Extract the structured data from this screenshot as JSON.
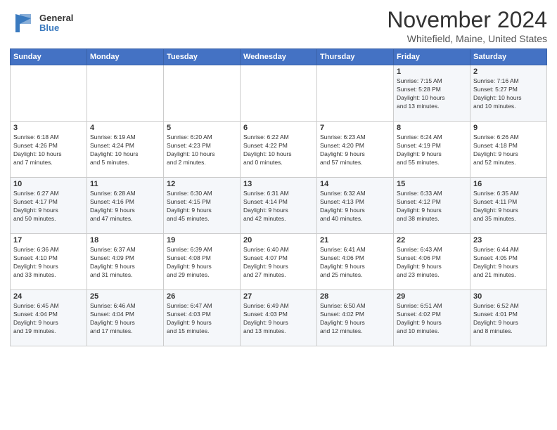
{
  "logo": {
    "general": "General",
    "blue": "Blue"
  },
  "title": {
    "month": "November 2024",
    "location": "Whitefield, Maine, United States"
  },
  "weekdays": [
    "Sunday",
    "Monday",
    "Tuesday",
    "Wednesday",
    "Thursday",
    "Friday",
    "Saturday"
  ],
  "weeks": [
    [
      {
        "day": "",
        "detail": ""
      },
      {
        "day": "",
        "detail": ""
      },
      {
        "day": "",
        "detail": ""
      },
      {
        "day": "",
        "detail": ""
      },
      {
        "day": "",
        "detail": ""
      },
      {
        "day": "1",
        "detail": "Sunrise: 7:15 AM\nSunset: 5:28 PM\nDaylight: 10 hours\nand 13 minutes."
      },
      {
        "day": "2",
        "detail": "Sunrise: 7:16 AM\nSunset: 5:27 PM\nDaylight: 10 hours\nand 10 minutes."
      }
    ],
    [
      {
        "day": "3",
        "detail": "Sunrise: 6:18 AM\nSunset: 4:26 PM\nDaylight: 10 hours\nand 7 minutes."
      },
      {
        "day": "4",
        "detail": "Sunrise: 6:19 AM\nSunset: 4:24 PM\nDaylight: 10 hours\nand 5 minutes."
      },
      {
        "day": "5",
        "detail": "Sunrise: 6:20 AM\nSunset: 4:23 PM\nDaylight: 10 hours\nand 2 minutes."
      },
      {
        "day": "6",
        "detail": "Sunrise: 6:22 AM\nSunset: 4:22 PM\nDaylight: 10 hours\nand 0 minutes."
      },
      {
        "day": "7",
        "detail": "Sunrise: 6:23 AM\nSunset: 4:20 PM\nDaylight: 9 hours\nand 57 minutes."
      },
      {
        "day": "8",
        "detail": "Sunrise: 6:24 AM\nSunset: 4:19 PM\nDaylight: 9 hours\nand 55 minutes."
      },
      {
        "day": "9",
        "detail": "Sunrise: 6:26 AM\nSunset: 4:18 PM\nDaylight: 9 hours\nand 52 minutes."
      }
    ],
    [
      {
        "day": "10",
        "detail": "Sunrise: 6:27 AM\nSunset: 4:17 PM\nDaylight: 9 hours\nand 50 minutes."
      },
      {
        "day": "11",
        "detail": "Sunrise: 6:28 AM\nSunset: 4:16 PM\nDaylight: 9 hours\nand 47 minutes."
      },
      {
        "day": "12",
        "detail": "Sunrise: 6:30 AM\nSunset: 4:15 PM\nDaylight: 9 hours\nand 45 minutes."
      },
      {
        "day": "13",
        "detail": "Sunrise: 6:31 AM\nSunset: 4:14 PM\nDaylight: 9 hours\nand 42 minutes."
      },
      {
        "day": "14",
        "detail": "Sunrise: 6:32 AM\nSunset: 4:13 PM\nDaylight: 9 hours\nand 40 minutes."
      },
      {
        "day": "15",
        "detail": "Sunrise: 6:33 AM\nSunset: 4:12 PM\nDaylight: 9 hours\nand 38 minutes."
      },
      {
        "day": "16",
        "detail": "Sunrise: 6:35 AM\nSunset: 4:11 PM\nDaylight: 9 hours\nand 35 minutes."
      }
    ],
    [
      {
        "day": "17",
        "detail": "Sunrise: 6:36 AM\nSunset: 4:10 PM\nDaylight: 9 hours\nand 33 minutes."
      },
      {
        "day": "18",
        "detail": "Sunrise: 6:37 AM\nSunset: 4:09 PM\nDaylight: 9 hours\nand 31 minutes."
      },
      {
        "day": "19",
        "detail": "Sunrise: 6:39 AM\nSunset: 4:08 PM\nDaylight: 9 hours\nand 29 minutes."
      },
      {
        "day": "20",
        "detail": "Sunrise: 6:40 AM\nSunset: 4:07 PM\nDaylight: 9 hours\nand 27 minutes."
      },
      {
        "day": "21",
        "detail": "Sunrise: 6:41 AM\nSunset: 4:06 PM\nDaylight: 9 hours\nand 25 minutes."
      },
      {
        "day": "22",
        "detail": "Sunrise: 6:43 AM\nSunset: 4:06 PM\nDaylight: 9 hours\nand 23 minutes."
      },
      {
        "day": "23",
        "detail": "Sunrise: 6:44 AM\nSunset: 4:05 PM\nDaylight: 9 hours\nand 21 minutes."
      }
    ],
    [
      {
        "day": "24",
        "detail": "Sunrise: 6:45 AM\nSunset: 4:04 PM\nDaylight: 9 hours\nand 19 minutes."
      },
      {
        "day": "25",
        "detail": "Sunrise: 6:46 AM\nSunset: 4:04 PM\nDaylight: 9 hours\nand 17 minutes."
      },
      {
        "day": "26",
        "detail": "Sunrise: 6:47 AM\nSunset: 4:03 PM\nDaylight: 9 hours\nand 15 minutes."
      },
      {
        "day": "27",
        "detail": "Sunrise: 6:49 AM\nSunset: 4:03 PM\nDaylight: 9 hours\nand 13 minutes."
      },
      {
        "day": "28",
        "detail": "Sunrise: 6:50 AM\nSunset: 4:02 PM\nDaylight: 9 hours\nand 12 minutes."
      },
      {
        "day": "29",
        "detail": "Sunrise: 6:51 AM\nSunset: 4:02 PM\nDaylight: 9 hours\nand 10 minutes."
      },
      {
        "day": "30",
        "detail": "Sunrise: 6:52 AM\nSunset: 4:01 PM\nDaylight: 9 hours\nand 8 minutes."
      }
    ]
  ]
}
